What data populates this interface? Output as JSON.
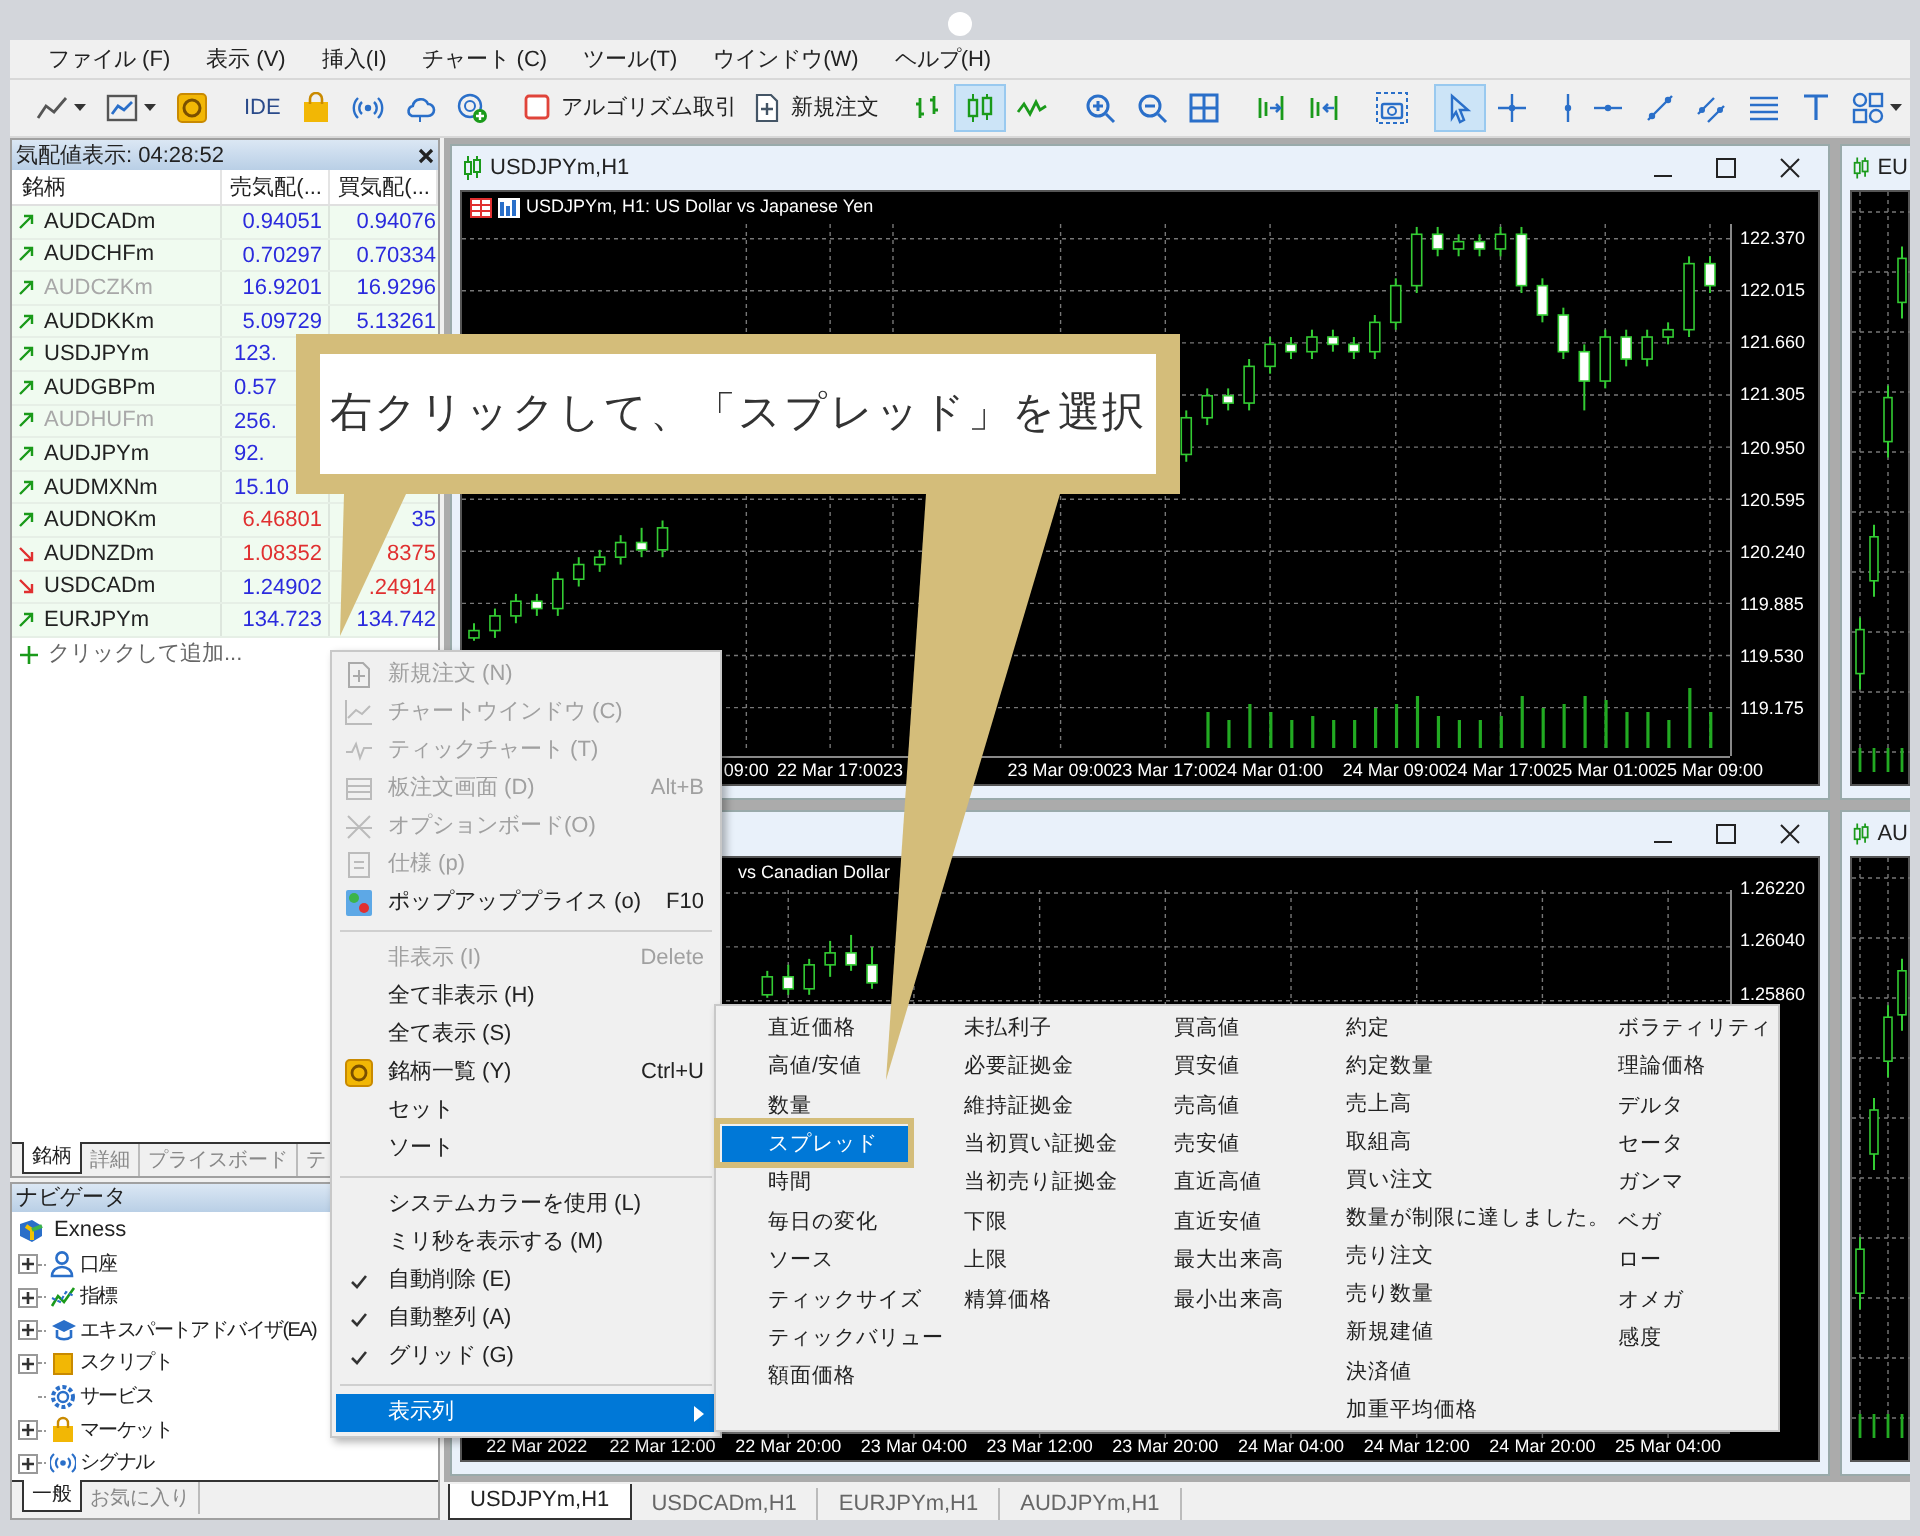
{
  "menu_bar": [
    "ファイル (F)",
    "表示 (V)",
    "挿入(I)",
    "チャート (C)",
    "ツール(T)",
    "ウインドウ(W)",
    "ヘルプ(H)"
  ],
  "toolbar": [
    {
      "kind": "icon",
      "selected": false,
      "dropdown": true
    },
    {
      "kind": "icon",
      "selected": false,
      "dropdown": true
    },
    {
      "kind": "icon",
      "selected": false,
      "dropdown": false
    },
    {
      "kind": "separator"
    },
    {
      "kind": "text",
      "label": "IDE"
    },
    {
      "kind": "icon",
      "selected": false,
      "dropdown": false
    },
    {
      "kind": "icon",
      "selected": false,
      "dropdown": false
    },
    {
      "kind": "icon",
      "selected": false,
      "dropdown": false
    },
    {
      "kind": "icon",
      "selected": false,
      "dropdown": false
    },
    {
      "kind": "separator"
    },
    {
      "kind": "icon_text",
      "label": "アルゴリズム取引"
    },
    {
      "kind": "icon_text",
      "label": "新規注文"
    },
    {
      "kind": "separator"
    },
    {
      "kind": "icon",
      "selected": false,
      "dropdown": false
    },
    {
      "kind": "icon",
      "selected": true,
      "dropdown": false
    },
    {
      "kind": "icon",
      "selected": false,
      "dropdown": false
    },
    {
      "kind": "separator"
    },
    {
      "kind": "icon",
      "selected": false,
      "dropdown": false
    },
    {
      "kind": "icon",
      "selected": false,
      "dropdown": false
    },
    {
      "kind": "icon",
      "selected": false,
      "dropdown": false
    },
    {
      "kind": "separator"
    },
    {
      "kind": "icon",
      "selected": false,
      "dropdown": false
    },
    {
      "kind": "icon",
      "selected": false,
      "dropdown": false
    },
    {
      "kind": "separator"
    },
    {
      "kind": "icon",
      "selected": false,
      "dropdown": false
    },
    {
      "kind": "separator"
    },
    {
      "kind": "icon",
      "selected": true,
      "dropdown": false
    },
    {
      "kind": "icon",
      "selected": false,
      "dropdown": false
    },
    {
      "kind": "separator"
    },
    {
      "kind": "icon",
      "selected": false,
      "dropdown": false
    },
    {
      "kind": "icon",
      "selected": false,
      "dropdown": false
    },
    {
      "kind": "icon",
      "selected": false,
      "dropdown": false
    },
    {
      "kind": "icon",
      "selected": false,
      "dropdown": false
    },
    {
      "kind": "icon",
      "selected": false,
      "dropdown": false
    },
    {
      "kind": "icon",
      "selected": false,
      "dropdown": false
    },
    {
      "kind": "icon",
      "selected": false,
      "dropdown": true
    }
  ],
  "market_watch": {
    "title": "気配値表示: 04:28:52",
    "columns": [
      "銘柄",
      "売気配(...",
      "買気配(..."
    ],
    "rows": [
      {
        "symbol": "AUDCADm",
        "bid": "0.94051",
        "ask": "0.94076",
        "falling": false,
        "disabled": false,
        "bid_down": false,
        "ask_down": false
      },
      {
        "symbol": "AUDCHFm",
        "bid": "0.70297",
        "ask": "0.70334",
        "falling": false,
        "disabled": false,
        "bid_down": false,
        "ask_down": false
      },
      {
        "symbol": "AUDCZKm",
        "bid": "16.9201",
        "ask": "16.9296",
        "falling": false,
        "disabled": true,
        "bid_down": false,
        "ask_down": false
      },
      {
        "symbol": "AUDDKKm",
        "bid": "5.09729",
        "ask": "5.13261",
        "falling": false,
        "disabled": false,
        "bid_down": false,
        "ask_down": false
      },
      {
        "symbol": "USDJPYm",
        "bid": "123.",
        "falling": false,
        "disabled": false,
        "bid_down": false
      },
      {
        "symbol": "AUDGBPm",
        "bid": "0.57",
        "falling": false,
        "disabled": false,
        "bid_down": false
      },
      {
        "symbol": "AUDHUFm",
        "bid": "256.",
        "falling": false,
        "disabled": true,
        "bid_down": false
      },
      {
        "symbol": "AUDJPYm",
        "bid": "92.",
        "falling": false,
        "disabled": false,
        "bid_down": false
      },
      {
        "symbol": "AUDMXNm",
        "bid": "15.10",
        "falling": false,
        "disabled": false,
        "bid_down": false
      },
      {
        "symbol": "AUDNOKm",
        "bid": "6.46801",
        "ask": "35",
        "falling": false,
        "disabled": false,
        "bid_down": true,
        "ask_down": false
      },
      {
        "symbol": "AUDNZDm",
        "bid": "1.08352",
        "ask": "8375",
        "falling": true,
        "disabled": false,
        "bid_down": true,
        "ask_down": true
      },
      {
        "symbol": "USDCADm",
        "bid": "1.24902",
        "ask": ".24914",
        "falling": true,
        "disabled": false,
        "bid_down": false,
        "ask_down": true
      },
      {
        "symbol": "EURJPYm",
        "bid": "134.723",
        "ask": "134.742",
        "falling": false,
        "disabled": false,
        "bid_down": false,
        "ask_down": false
      }
    ],
    "add_row": "クリックして追加...",
    "tabs": [
      {
        "label": "銘柄",
        "selected": true
      },
      {
        "label": "詳細",
        "selected": false
      },
      {
        "label": "プライスボード",
        "selected": false
      },
      {
        "label": "テ",
        "selected": false
      }
    ]
  },
  "navigator": {
    "title": "ナビゲータ",
    "root": {
      "label": "Exness",
      "children": [
        {
          "label": "口座",
          "expandable": true,
          "expanded": false
        },
        {
          "label": "指標",
          "expandable": true,
          "expanded": false
        },
        {
          "label": "エキスパートアドバイザ(EA)",
          "expandable": true,
          "expanded": false
        },
        {
          "label": "スクリプト",
          "expandable": true,
          "expanded": false
        },
        {
          "label": "サービス",
          "expandable": false
        },
        {
          "label": "マーケット",
          "expandable": true,
          "expanded": false
        },
        {
          "label": "シグナル",
          "expandable": true,
          "expanded": false
        }
      ]
    },
    "tabs": [
      {
        "label": "一般",
        "selected": true
      },
      {
        "label": "お気に入り",
        "selected": false
      }
    ]
  },
  "chart_windows": [
    {
      "title": "USDJPYm,H1",
      "header": "USDJPYm, H1:  US Dollar vs Japanese Yen",
      "chart_data": {
        "type": "candlestick",
        "categories": [
          null,
          null,
          null,
          null,
          null,
          null,
          null,
          null,
          null,
          null,
          null,
          null,
          null,
          "09:00",
          null,
          null,
          null,
          "22 Mar 17:00",
          null,
          null,
          "23",
          null,
          null,
          null,
          null,
          null,
          null,
          null,
          "23 Mar 09:00",
          null,
          null,
          null,
          null,
          "23 Mar 17:00",
          null,
          null,
          null,
          null,
          "24 Mar 01:00",
          null,
          null,
          null,
          null,
          null,
          "24 Mar 09:00",
          null,
          null,
          null,
          null,
          "24 Mar 17:00",
          null,
          null,
          null,
          null,
          "25 Mar 01:00",
          null,
          null,
          null,
          null,
          "25 Mar 09:00"
        ],
        "ylim": [
          118.9,
          122.47
        ],
        "grid": true,
        "yticks": [
          {
            "value": 122.37,
            "label": "122.370"
          },
          {
            "value": 122.015,
            "label": "122.015"
          },
          {
            "value": 121.66,
            "label": "121.660"
          },
          {
            "value": 121.305,
            "label": "121.305"
          },
          {
            "value": 120.95,
            "label": "120.950"
          },
          {
            "value": 120.595,
            "label": "120.595"
          },
          {
            "value": 120.24,
            "label": "120.240"
          },
          {
            "value": 119.885,
            "label": "119.885"
          },
          {
            "value": 119.53,
            "label": "119.530"
          },
          {
            "value": 119.175,
            "label": "119.175"
          }
        ],
        "ohlc": [
          [
            119.65,
            119.75,
            119.63,
            119.7
          ],
          [
            119.7,
            119.85,
            119.65,
            119.8
          ],
          [
            119.8,
            119.95,
            119.75,
            119.9
          ],
          [
            119.9,
            119.95,
            119.8,
            119.85
          ],
          [
            119.85,
            120.1,
            119.8,
            120.05
          ],
          [
            120.05,
            120.2,
            120.0,
            120.15
          ],
          [
            120.15,
            120.25,
            120.1,
            120.2
          ],
          [
            120.2,
            120.35,
            120.15,
            120.3
          ],
          [
            120.3,
            120.4,
            120.2,
            120.25
          ],
          [
            120.25,
            120.45,
            120.2,
            120.4
          ],
          null,
          null,
          null,
          null,
          null,
          null,
          null,
          null,
          null,
          null,
          null,
          null,
          null,
          null,
          null,
          null,
          null,
          null,
          null,
          null,
          null,
          null,
          null,
          null,
          [
            120.9,
            121.2,
            120.85,
            121.15
          ],
          [
            121.15,
            121.35,
            121.1,
            121.3
          ],
          [
            121.3,
            121.35,
            121.2,
            121.25
          ],
          [
            121.25,
            121.55,
            121.2,
            121.5
          ],
          [
            121.5,
            121.7,
            121.45,
            121.65
          ],
          [
            121.65,
            121.7,
            121.55,
            121.6
          ],
          [
            121.6,
            121.75,
            121.55,
            121.7
          ],
          [
            121.7,
            121.75,
            121.6,
            121.65
          ],
          [
            121.65,
            121.7,
            121.55,
            121.6
          ],
          [
            121.6,
            121.85,
            121.55,
            121.8
          ],
          [
            121.8,
            122.1,
            121.75,
            122.05
          ],
          [
            122.05,
            122.45,
            122.0,
            122.4
          ],
          [
            122.4,
            122.45,
            122.25,
            122.3
          ],
          [
            122.3,
            122.4,
            122.25,
            122.35
          ],
          [
            122.35,
            122.4,
            122.25,
            122.3
          ],
          [
            122.3,
            122.45,
            122.25,
            122.4
          ],
          [
            122.4,
            122.45,
            122.0,
            122.05
          ],
          [
            122.05,
            122.1,
            121.8,
            121.85
          ],
          [
            121.85,
            121.9,
            121.55,
            121.6
          ],
          [
            121.6,
            121.65,
            121.2,
            121.4
          ],
          [
            121.4,
            121.75,
            121.35,
            121.7
          ],
          [
            121.7,
            121.75,
            121.5,
            121.55
          ],
          [
            121.55,
            121.75,
            121.5,
            121.7
          ],
          [
            121.7,
            121.8,
            121.65,
            121.75
          ],
          [
            121.75,
            122.25,
            121.7,
            122.2
          ],
          [
            122.2,
            122.25,
            122.0,
            122.05
          ]
        ]
      }
    },
    {
      "header": "vs Canadian Dollar",
      "chart_data": {
        "type": "candlestick",
        "categories": [
          null,
          null,
          null,
          "22 Mar 2022",
          null,
          null,
          null,
          null,
          null,
          "22 Mar 12:00",
          null,
          null,
          null,
          null,
          null,
          "22 Mar 20:00",
          null,
          null,
          null,
          null,
          null,
          "23 Mar 04:00",
          null,
          null,
          null,
          null,
          null,
          "23 Mar 12:00",
          null,
          null,
          null,
          null,
          null,
          "23 Mar 20:00",
          null,
          null,
          null,
          null,
          null,
          "24 Mar 04:00",
          null,
          null,
          null,
          null,
          null,
          "24 Mar 12:00",
          null,
          null,
          null,
          null,
          null,
          "24 Mar 20:00",
          null,
          null,
          null,
          null,
          null,
          "25 Mar 04:00",
          null,
          null
        ],
        "ylim": [
          1.244,
          1.2623
        ],
        "grid": true,
        "yticks": [
          {
            "value": 1.2622,
            "label": "1.26220"
          },
          {
            "value": 1.2604,
            "label": "1.26040"
          },
          {
            "value": 1.2586,
            "label": "1.25860"
          }
        ],
        "ohlc": [
          null,
          null,
          null,
          null,
          null,
          null,
          null,
          null,
          null,
          null,
          null,
          null,
          null,
          null,
          [
            1.2588,
            1.2596,
            1.2587,
            1.2594
          ],
          [
            1.2594,
            1.2598,
            1.2588,
            1.259
          ],
          [
            1.259,
            1.26,
            1.2588,
            1.2598
          ],
          [
            1.2598,
            1.2606,
            1.2594,
            1.2602
          ],
          [
            1.2602,
            1.2608,
            1.2596,
            1.2598
          ],
          [
            1.2598,
            1.2604,
            1.259,
            1.2592
          ],
          null,
          null,
          null,
          null,
          null,
          null,
          null,
          null,
          null,
          null,
          null,
          null,
          null,
          null,
          null,
          null,
          null,
          null,
          null,
          null,
          null,
          null,
          null,
          null,
          null,
          null,
          null,
          null,
          null,
          null,
          null,
          null,
          null,
          null,
          null,
          null,
          null,
          null,
          null,
          null
        ]
      }
    },
    {
      "title": "EU"
    },
    {
      "title": "AU"
    }
  ],
  "chart_tabs": [
    {
      "label": "USDJPYm,H1",
      "selected": true
    },
    {
      "label": "USDCADm,H1",
      "selected": false
    },
    {
      "label": "EURJPYm,H1",
      "selected": false
    },
    {
      "label": "AUDJPYm,H1",
      "selected": false
    }
  ],
  "context_menu": [
    {
      "kind": "item",
      "label": "新規注文 (N)",
      "disabled": true,
      "checked": false,
      "selected": false
    },
    {
      "kind": "item",
      "label": "チャートウインドウ (C)",
      "disabled": true,
      "checked": false,
      "selected": false
    },
    {
      "kind": "item",
      "label": "ティックチャート (T)",
      "disabled": true,
      "checked": false,
      "selected": false
    },
    {
      "kind": "item",
      "label": "板注文画面 (D)",
      "shortcut": "Alt+B",
      "disabled": true,
      "checked": false,
      "selected": false
    },
    {
      "kind": "item",
      "label": "オプションボード(O)",
      "disabled": true,
      "checked": false,
      "selected": false
    },
    {
      "kind": "item",
      "label": "仕様 (p)",
      "disabled": true,
      "checked": false,
      "selected": false
    },
    {
      "kind": "item",
      "label": "ポップアッププライス (o)",
      "shortcut": "F10",
      "disabled": false,
      "checked": false,
      "selected": false
    },
    {
      "kind": "separator"
    },
    {
      "kind": "item",
      "label": "非表示 (I)",
      "shortcut": "Delete",
      "disabled": true,
      "checked": false,
      "selected": false
    },
    {
      "kind": "item",
      "label": "全て非表示 (H)",
      "disabled": false,
      "checked": false,
      "selected": false
    },
    {
      "kind": "item",
      "label": "全て表示 (S)",
      "disabled": false,
      "checked": false,
      "selected": false
    },
    {
      "kind": "item",
      "label": "銘柄一覧 (Y)",
      "shortcut": "Ctrl+U",
      "disabled": false,
      "checked": false,
      "selected": false
    },
    {
      "kind": "item",
      "label": "セット",
      "disabled": false,
      "checked": false,
      "selected": false
    },
    {
      "kind": "item",
      "label": "ソート",
      "disabled": false,
      "checked": false,
      "selected": false
    },
    {
      "kind": "separator"
    },
    {
      "kind": "item",
      "label": "システムカラーを使用 (L)",
      "disabled": false,
      "checked": false,
      "selected": false
    },
    {
      "kind": "item",
      "label": "ミリ秒を表示する (M)",
      "disabled": false,
      "checked": false,
      "selected": false
    },
    {
      "kind": "item",
      "label": "自動削除 (E)",
      "disabled": false,
      "checked": true,
      "selected": false
    },
    {
      "kind": "item",
      "label": "自動整列 (A)",
      "disabled": false,
      "checked": true,
      "selected": false
    },
    {
      "kind": "item",
      "label": "グリッド (G)",
      "disabled": false,
      "checked": true,
      "selected": false
    },
    {
      "kind": "separator"
    },
    {
      "kind": "submenu",
      "label": "表示列",
      "disabled": false,
      "checked": false,
      "selected": true
    }
  ],
  "column_submenu": [
    [
      {
        "label": "直近価格",
        "selected": false
      },
      {
        "label": "高値/安値",
        "selected": false
      },
      {
        "label": "数量",
        "selected": false
      },
      {
        "label": "スプレッド",
        "selected": true
      },
      {
        "label": "時間",
        "selected": false
      },
      {
        "label": "毎日の変化",
        "selected": false
      },
      {
        "label": "ソース",
        "selected": false
      },
      {
        "label": "ティックサイズ",
        "selected": false
      },
      {
        "label": "ティックバリュー",
        "selected": false
      },
      {
        "label": "額面価格",
        "selected": false
      }
    ],
    [
      {
        "label": "未払利子",
        "selected": false
      },
      {
        "label": "必要証拠金",
        "selected": false
      },
      {
        "label": "維持証拠金",
        "selected": false
      },
      {
        "label": "当初買い証拠金",
        "selected": false
      },
      {
        "label": "当初売り証拠金",
        "selected": false
      },
      {
        "label": "下限",
        "selected": false
      },
      {
        "label": "上限",
        "selected": false
      },
      {
        "label": "精算価格",
        "selected": false
      }
    ],
    [
      {
        "label": "買高値",
        "selected": false
      },
      {
        "label": "買安値",
        "selected": false
      },
      {
        "label": "売高値",
        "selected": false
      },
      {
        "label": "売安値",
        "selected": false
      },
      {
        "label": "直近高値",
        "selected": false
      },
      {
        "label": "直近安値",
        "selected": false
      },
      {
        "label": "最大出来高",
        "selected": false
      },
      {
        "label": "最小出来高",
        "selected": false
      }
    ],
    [
      {
        "label": "約定",
        "selected": false
      },
      {
        "label": "約定数量",
        "selected": false
      },
      {
        "label": "売上高",
        "selected": false
      },
      {
        "label": "取組高",
        "selected": false
      },
      {
        "label": "買い注文",
        "selected": false
      },
      {
        "label": "数量が制限に達しました。",
        "selected": false
      },
      {
        "label": "売り注文",
        "selected": false
      },
      {
        "label": "売り数量",
        "selected": false
      },
      {
        "label": "新規建値",
        "selected": false
      },
      {
        "label": "決済値",
        "selected": false
      },
      {
        "label": "加重平均価格",
        "selected": false
      }
    ],
    [
      {
        "label": "ボラティリティ",
        "selected": false
      },
      {
        "label": "理論価格",
        "selected": false
      },
      {
        "label": "デルタ",
        "selected": false
      },
      {
        "label": "セータ",
        "selected": false
      },
      {
        "label": "ガンマ",
        "selected": false
      },
      {
        "label": "ベガ",
        "selected": false
      },
      {
        "label": "ロー",
        "selected": false
      },
      {
        "label": "オメガ",
        "selected": false
      },
      {
        "label": "感度",
        "selected": false
      }
    ]
  ],
  "callout": {
    "text": "右クリックして、「スプレッド」を選択"
  }
}
